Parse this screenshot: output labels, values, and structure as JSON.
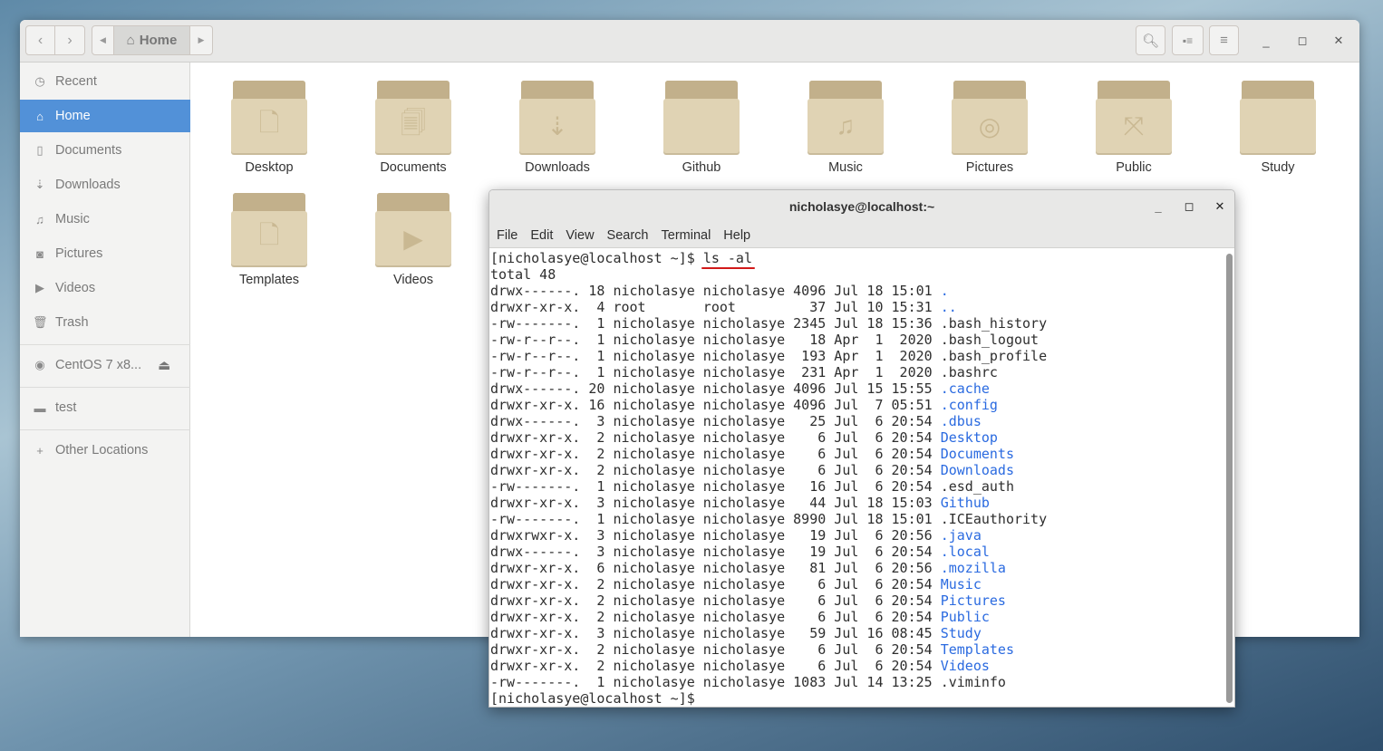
{
  "file_manager": {
    "breadcrumb": "Home",
    "sidebar": [
      {
        "label": "Recent",
        "icon": "clock-icon"
      },
      {
        "label": "Home",
        "icon": "home-icon",
        "active": true
      },
      {
        "label": "Documents",
        "icon": "document-icon"
      },
      {
        "label": "Downloads",
        "icon": "download-icon"
      },
      {
        "label": "Music",
        "icon": "music-icon"
      },
      {
        "label": "Pictures",
        "icon": "camera-icon"
      },
      {
        "label": "Videos",
        "icon": "video-icon"
      },
      {
        "label": "Trash",
        "icon": "trash-icon"
      }
    ],
    "device": {
      "label": "CentOS 7 x8...",
      "icon": "disk-icon"
    },
    "bookmark": {
      "label": "test",
      "icon": "folder-icon"
    },
    "other": {
      "label": "Other Locations",
      "icon": "plus-icon"
    },
    "folders": [
      {
        "label": "Desktop",
        "glyph": "🗋"
      },
      {
        "label": "Documents",
        "glyph": "🗐"
      },
      {
        "label": "Downloads",
        "glyph": "⇣"
      },
      {
        "label": "Github",
        "glyph": ""
      },
      {
        "label": "Music",
        "glyph": "♫"
      },
      {
        "label": "Pictures",
        "glyph": "◎"
      },
      {
        "label": "Public",
        "glyph": "⤧"
      },
      {
        "label": "Study",
        "glyph": ""
      },
      {
        "label": "Templates",
        "glyph": "🗋"
      },
      {
        "label": "Videos",
        "glyph": "▶"
      }
    ]
  },
  "terminal": {
    "title": "nicholasye@localhost:~",
    "menu": [
      "File",
      "Edit",
      "View",
      "Search",
      "Terminal",
      "Help"
    ],
    "prompt": "[nicholasye@localhost ~]$ ",
    "command": "ls -al",
    "total": "total 48",
    "lines": [
      {
        "meta": "drwx------. 18 nicholasye nicholasye 4096 Jul 18 15:01 ",
        "name": ".",
        "dir": true
      },
      {
        "meta": "drwxr-xr-x.  4 root       root         37 Jul 10 15:31 ",
        "name": "..",
        "dir": true
      },
      {
        "meta": "-rw-------.  1 nicholasye nicholasye 2345 Jul 18 15:36 ",
        "name": ".bash_history",
        "dir": false
      },
      {
        "meta": "-rw-r--r--.  1 nicholasye nicholasye   18 Apr  1  2020 ",
        "name": ".bash_logout",
        "dir": false
      },
      {
        "meta": "-rw-r--r--.  1 nicholasye nicholasye  193 Apr  1  2020 ",
        "name": ".bash_profile",
        "dir": false
      },
      {
        "meta": "-rw-r--r--.  1 nicholasye nicholasye  231 Apr  1  2020 ",
        "name": ".bashrc",
        "dir": false
      },
      {
        "meta": "drwx------. 20 nicholasye nicholasye 4096 Jul 15 15:55 ",
        "name": ".cache",
        "dir": true
      },
      {
        "meta": "drwxr-xr-x. 16 nicholasye nicholasye 4096 Jul  7 05:51 ",
        "name": ".config",
        "dir": true
      },
      {
        "meta": "drwx------.  3 nicholasye nicholasye   25 Jul  6 20:54 ",
        "name": ".dbus",
        "dir": true
      },
      {
        "meta": "drwxr-xr-x.  2 nicholasye nicholasye    6 Jul  6 20:54 ",
        "name": "Desktop",
        "dir": true
      },
      {
        "meta": "drwxr-xr-x.  2 nicholasye nicholasye    6 Jul  6 20:54 ",
        "name": "Documents",
        "dir": true
      },
      {
        "meta": "drwxr-xr-x.  2 nicholasye nicholasye    6 Jul  6 20:54 ",
        "name": "Downloads",
        "dir": true
      },
      {
        "meta": "-rw-------.  1 nicholasye nicholasye   16 Jul  6 20:54 ",
        "name": ".esd_auth",
        "dir": false
      },
      {
        "meta": "drwxr-xr-x.  3 nicholasye nicholasye   44 Jul 18 15:03 ",
        "name": "Github",
        "dir": true
      },
      {
        "meta": "-rw-------.  1 nicholasye nicholasye 8990 Jul 18 15:01 ",
        "name": ".ICEauthority",
        "dir": false
      },
      {
        "meta": "drwxrwxr-x.  3 nicholasye nicholasye   19 Jul  6 20:56 ",
        "name": ".java",
        "dir": true
      },
      {
        "meta": "drwx------.  3 nicholasye nicholasye   19 Jul  6 20:54 ",
        "name": ".local",
        "dir": true
      },
      {
        "meta": "drwxr-xr-x.  6 nicholasye nicholasye   81 Jul  6 20:56 ",
        "name": ".mozilla",
        "dir": true
      },
      {
        "meta": "drwxr-xr-x.  2 nicholasye nicholasye    6 Jul  6 20:54 ",
        "name": "Music",
        "dir": true
      },
      {
        "meta": "drwxr-xr-x.  2 nicholasye nicholasye    6 Jul  6 20:54 ",
        "name": "Pictures",
        "dir": true
      },
      {
        "meta": "drwxr-xr-x.  2 nicholasye nicholasye    6 Jul  6 20:54 ",
        "name": "Public",
        "dir": true
      },
      {
        "meta": "drwxr-xr-x.  3 nicholasye nicholasye   59 Jul 16 08:45 ",
        "name": "Study",
        "dir": true
      },
      {
        "meta": "drwxr-xr-x.  2 nicholasye nicholasye    6 Jul  6 20:54 ",
        "name": "Templates",
        "dir": true
      },
      {
        "meta": "drwxr-xr-x.  2 nicholasye nicholasye    6 Jul  6 20:54 ",
        "name": "Videos",
        "dir": true
      },
      {
        "meta": "-rw-------.  1 nicholasye nicholasye 1083 Jul 14 13:25 ",
        "name": ".viminfo",
        "dir": false
      }
    ],
    "dir_color": "#2a6ae0",
    "highlight_color": "#d21a1a"
  }
}
